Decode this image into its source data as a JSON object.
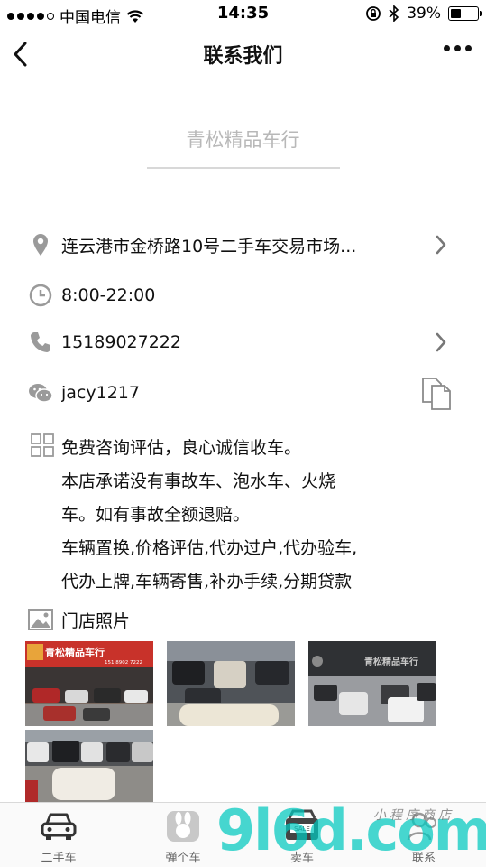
{
  "status_bar": {
    "carrier": "中国电信",
    "time": "14:35",
    "battery": "39%",
    "battery_level": 0.39
  },
  "nav": {
    "title": "联系我们"
  },
  "store": {
    "name": "青松精品车行"
  },
  "contact": {
    "address": "连云港市金桥路10号二手车交易市场...",
    "hours": "8:00-22:00",
    "phone": "15189027222",
    "wechat": "jacy1217",
    "description": "免费咨询评估，良心诚信收车。\n本店承诺没有事故车、泡水车、火烧\n车。如有事故全额退赔。\n车辆置换,价格评估,代办过户,代办验车,\n代办上牌,车辆寄售,补办手续,分期贷款"
  },
  "photos": {
    "label": "门店照片",
    "sign_text_1": "青松精品车行",
    "sign_phone_1": "151 8902 7222",
    "sign_text_3": "青松精品车行"
  },
  "tab_bar": {
    "tabs": [
      {
        "label": "二手车",
        "icon": "car-icon"
      },
      {
        "label": "弹个车",
        "icon": "rabbit-icon"
      },
      {
        "label": "卖车",
        "icon": "sale-icon"
      },
      {
        "label": "联系",
        "icon": "contact-icon"
      }
    ]
  },
  "watermark": {
    "brand": "9l6d.com",
    "tagline": "小程序商店"
  }
}
